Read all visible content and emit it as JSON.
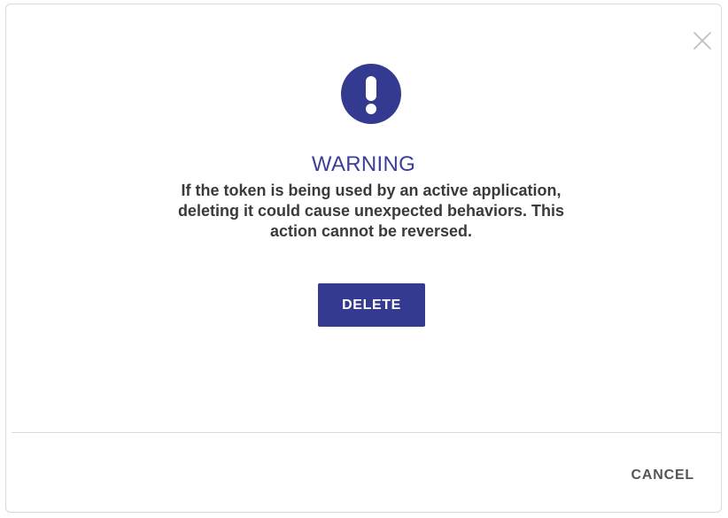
{
  "dialog": {
    "title": "WARNING",
    "message": "If the token is being used by an active application, deleting it could cause unexpected behaviors. This action cannot be reversed.",
    "delete_label": "DELETE",
    "cancel_label": "CANCEL",
    "icons": {
      "close": "close-icon",
      "warning": "exclamation-circle-icon"
    },
    "colors": {
      "accent": "#333a8f",
      "title": "#3b3f97",
      "text": "#3a3a3a",
      "muted": "#555555"
    }
  }
}
